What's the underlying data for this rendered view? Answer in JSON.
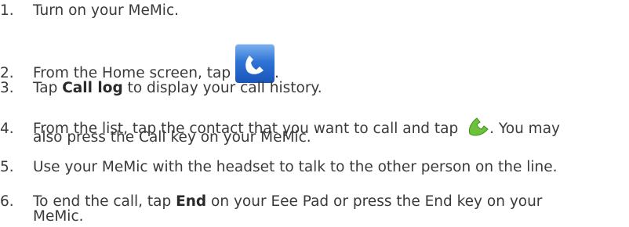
{
  "steps": [
    {
      "num": "1.",
      "text": "Turn on your MeMic."
    },
    {
      "num": "2.",
      "before": "From the Home screen, tap ",
      "after": ".",
      "icon": "phone-app-icon"
    },
    {
      "num": "3.",
      "before": "Tap ",
      "bold": "Call log",
      "after": " to display your call history."
    },
    {
      "num": "4.",
      "before": "From the list, tap the contact that you want to call and tap ",
      "after": ". You may",
      "cont": "also press the Call key on your MeMic.",
      "icon": "green-phone-icon"
    },
    {
      "num": "5.",
      "text": "Use your MeMic with the headset to talk to the other person on the line."
    },
    {
      "num": "6.",
      "before": "To end the call, tap ",
      "bold": "End",
      "after": " on your Eee Pad or press the End key on your",
      "cont": "MeMic."
    }
  ],
  "colors": {
    "text": "#3a3a3a",
    "app_icon": "#2f74d6",
    "green_phone": "#6cc33a"
  }
}
